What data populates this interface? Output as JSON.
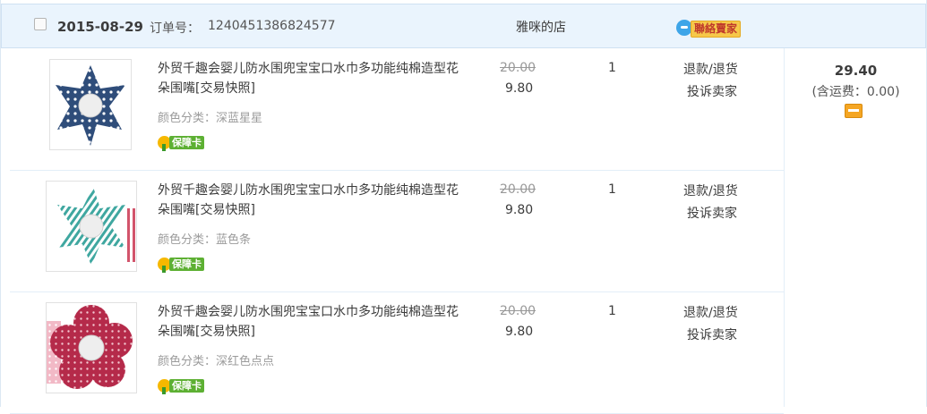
{
  "order": {
    "date": "2015-08-29",
    "order_label": "订单号：",
    "order_number": "1240451386824577",
    "shop_name": "雅咪的店",
    "contact_label": "聯絡賣家"
  },
  "items": [
    {
      "title": "外贸千趣会婴儿防水围兜宝宝口水巾多功能纯棉造型花朵围嘴[交易快照]",
      "sku_label": "颜色分类：",
      "sku_value": "深蓝星星",
      "guarantee": "保障卡",
      "original_price": "20.00",
      "price": "9.80",
      "quantity": "1",
      "refund": "退款/退货",
      "complain": "投诉卖家"
    },
    {
      "title": "外贸千趣会婴儿防水围兜宝宝口水巾多功能纯棉造型花朵围嘴[交易快照]",
      "sku_label": "颜色分类：",
      "sku_value": "蓝色条",
      "guarantee": "保障卡",
      "original_price": "20.00",
      "price": "9.80",
      "quantity": "1",
      "refund": "退款/退货",
      "complain": "投诉卖家"
    },
    {
      "title": "外贸千趣会婴儿防水围兜宝宝口水巾多功能纯棉造型花朵围嘴[交易快照]",
      "sku_label": "颜色分类：",
      "sku_value": "深红色点点",
      "guarantee": "保障卡",
      "original_price": "20.00",
      "price": "9.80",
      "quantity": "1",
      "refund": "退款/退货",
      "complain": "投诉卖家"
    }
  ],
  "summary": {
    "total": "29.40",
    "shipping": "(含运费：0.00)"
  },
  "colors": {
    "header_bg": "#eaf4fd",
    "guarantee_green": "#5db033",
    "contact_yellow": "#f6c84a",
    "item1": "#2f4d7a",
    "item2": "#3fa7a0",
    "item3": "#b52a4a"
  },
  "icons": {
    "checkbox": "checkbox-icon",
    "contact": "chat-bubble-icon",
    "guarantee": "flower-badge-icon",
    "payment": "card-icon"
  }
}
